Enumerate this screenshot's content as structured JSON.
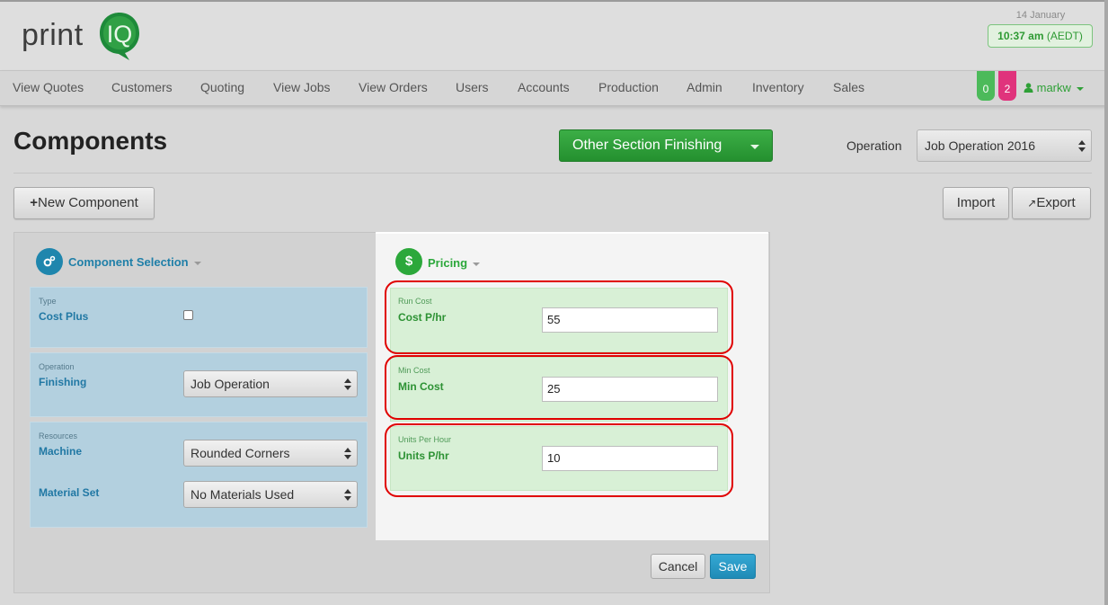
{
  "brand": {
    "logo_text_print": "print",
    "logo_text_iq": "IQ"
  },
  "header": {
    "date": "14 January",
    "time": "10:37 am",
    "timezone": "(AEDT)"
  },
  "nav": {
    "items": [
      "View Quotes",
      "Customers",
      "Quoting",
      "View Jobs",
      "View Orders",
      "Users",
      "Accounts",
      "Production",
      "Admin",
      "Inventory",
      "Sales"
    ],
    "badges": [
      {
        "count": "0",
        "color": "#4cba5a"
      },
      {
        "count": "2",
        "color": "#e0337c"
      }
    ],
    "user": "markw"
  },
  "page": {
    "title": "Components",
    "section_dropdown": "Other Section Finishing",
    "operation_label": "Operation",
    "operation_value": "Job Operation 2016",
    "new_component": "New Component",
    "import": "Import",
    "export": "Export"
  },
  "component_selection": {
    "heading": "Component Selection",
    "type_label": "Type",
    "type_value": "Cost Plus",
    "cost_plus_checked": false,
    "operation_label": "Operation",
    "operation_value": "Finishing",
    "operation_select": "Job Operation",
    "resources_label": "Resources",
    "machine_label": "Machine",
    "machine_select": "Rounded Corners",
    "material_label": "Material Set",
    "material_select": "No Materials Used"
  },
  "pricing": {
    "heading": "Pricing",
    "run_cost_small": "Run Cost",
    "run_cost_label": "Cost P/hr",
    "run_cost_value": "55",
    "min_cost_small": "Min Cost",
    "min_cost_label": "Min Cost",
    "min_cost_value": "25",
    "units_small": "Units Per Hour",
    "units_label": "Units P/hr",
    "units_value": "10"
  },
  "actions": {
    "cancel": "Cancel",
    "save": "Save"
  },
  "colors": {
    "green": "#2fa037",
    "blue": "#2178a4",
    "highlight": "#e00000"
  }
}
